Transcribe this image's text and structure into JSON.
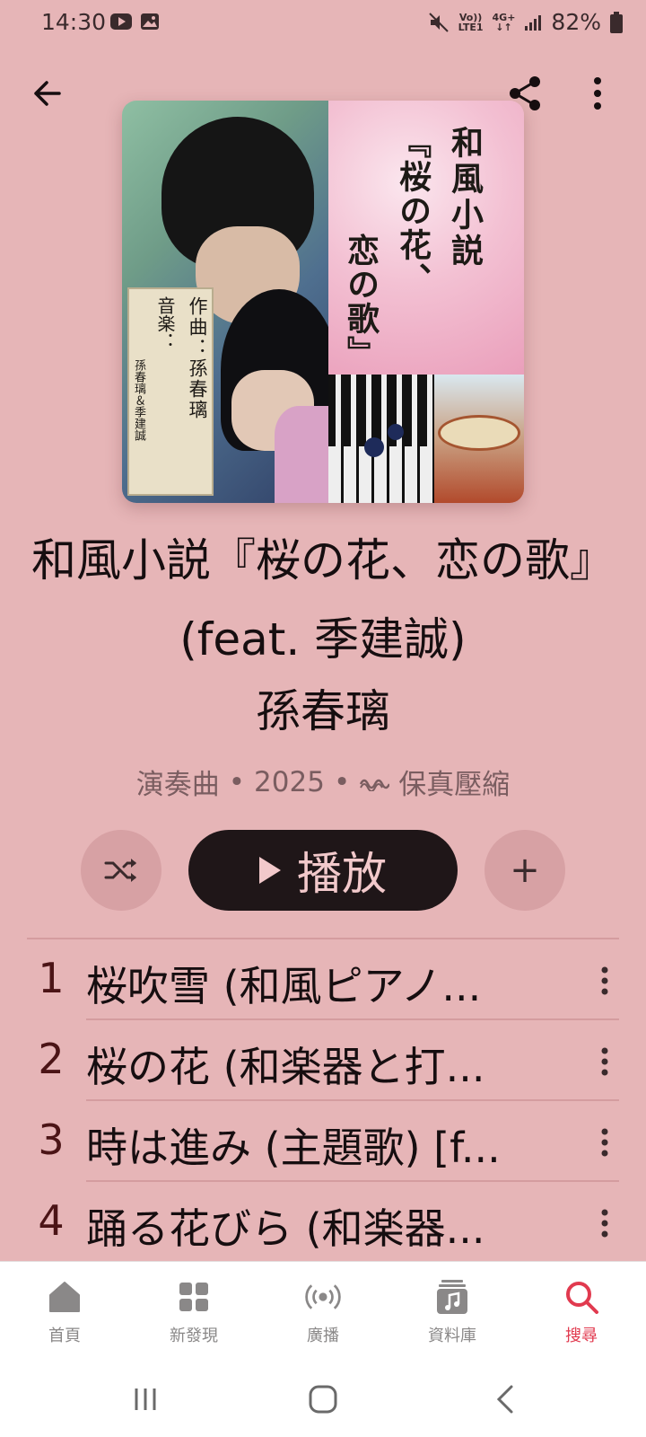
{
  "status_bar": {
    "time": "14:30",
    "network_top": "Vo))",
    "network_bottom": "LTE1",
    "net_type": "4G+",
    "battery": "82%"
  },
  "album": {
    "art_title_lines": [
      "和風小説",
      "『桜の花、",
      "恋の歌』"
    ],
    "art_credits": [
      "作曲：孫春璃",
      "音楽：",
      "孫春璃＆季建誠"
    ],
    "title": "和風小説『桜の花、恋の歌』 (feat. 季建誠)",
    "artist": "孫春璃",
    "meta_genre": "演奏曲",
    "meta_year": "2025",
    "meta_quality": "保真壓縮"
  },
  "actions": {
    "play_label": "播放",
    "add_label": "+"
  },
  "tracks": [
    {
      "num": "1",
      "title": "桜吹雪 (和風ピアノ..."
    },
    {
      "num": "2",
      "title": "桜の花 (和楽器と打..."
    },
    {
      "num": "3",
      "title": "時は進み (主題歌) [f..."
    },
    {
      "num": "4",
      "title": "踊る花びら (和楽器..."
    }
  ],
  "bottom_nav": [
    {
      "label": "首頁",
      "icon": "home-icon"
    },
    {
      "label": "新發現",
      "icon": "grid-icon"
    },
    {
      "label": "廣播",
      "icon": "radio-icon"
    },
    {
      "label": "資料庫",
      "icon": "library-icon"
    },
    {
      "label": "搜尋",
      "icon": "search-icon",
      "active": true
    }
  ],
  "colors": {
    "background": "#e6b5b7",
    "accent": "#e13a4f",
    "play_button": "#1f1618"
  }
}
